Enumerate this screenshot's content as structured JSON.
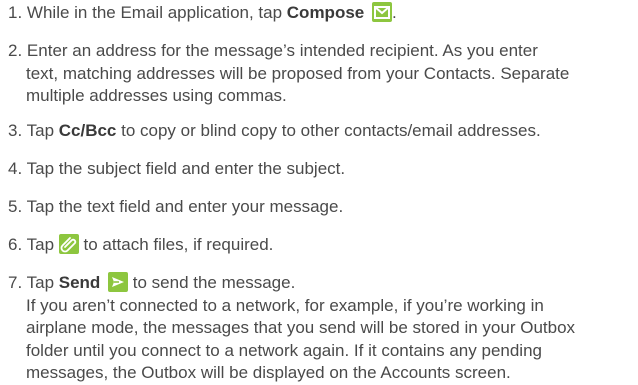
{
  "steps": [
    {
      "num": "1.",
      "pre": "While in the Email application, tap ",
      "bold": "Compose",
      "icon": "compose-icon",
      "post": "."
    },
    {
      "num": "2.",
      "line1": "Enter an address for the message’s intended recipient. As you enter",
      "line2": "text, matching addresses will be proposed from your Contacts. Separate",
      "line3": "multiple addresses using commas."
    },
    {
      "num": "3.",
      "pre": "Tap ",
      "bold": "Cc/Bcc",
      "post": " to copy or blind copy to other contacts/email addresses."
    },
    {
      "num": "4.",
      "text": "Tap the subject field and enter the subject."
    },
    {
      "num": "5.",
      "text": "Tap the text field and enter your message."
    },
    {
      "num": "6.",
      "pre": "Tap ",
      "icon": "attach-icon",
      "post": " to attach files, if required."
    },
    {
      "num": "7.",
      "pre": "Tap ",
      "bold": "Send",
      "icon": "send-icon",
      "post": " to send the message.",
      "note1": "If you aren’t connected to a network, for example, if you’re working in",
      "note2": "airplane mode, the messages that you send will be stored in your Outbox",
      "note3": "folder until you connect to a network again. If it contains any pending",
      "note4": "messages, the Outbox will be displayed on the Accounts screen."
    }
  ],
  "colors": {
    "icon_green": "#8dc63f",
    "text": "#4a4a4a"
  }
}
